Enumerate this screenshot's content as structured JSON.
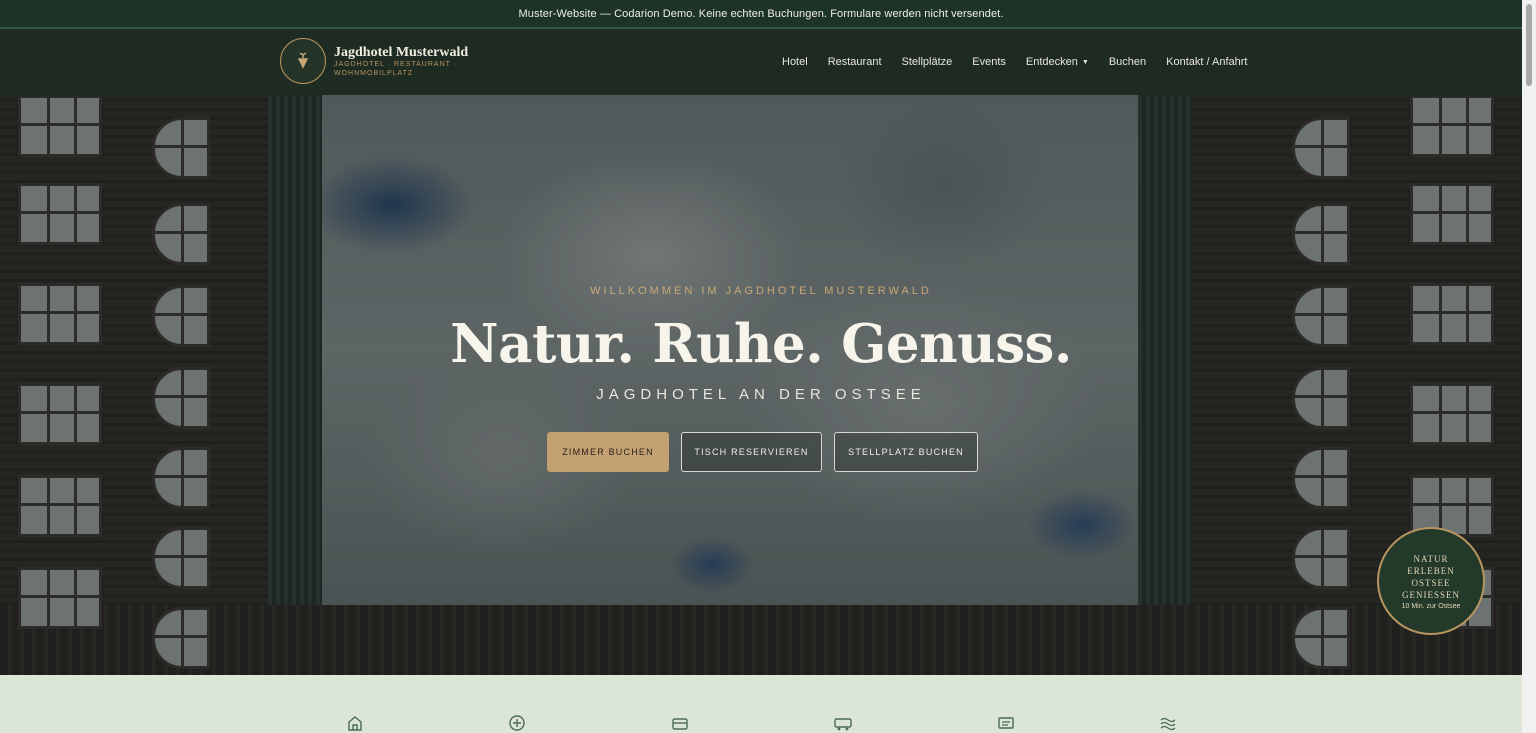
{
  "notice": {
    "text": "Muster-Website — Codarion Demo. Keine echten Buchungen. Formulare werden nicht versendet."
  },
  "brand": {
    "name": "Jagdhotel Musterwald",
    "tagline": "JAGDHOTEL · RESTAURANT · WOHNMOBILPLATZ"
  },
  "nav": {
    "items": [
      {
        "label": "Hotel"
      },
      {
        "label": "Restaurant"
      },
      {
        "label": "Stellplätze"
      },
      {
        "label": "Events"
      },
      {
        "label": "Entdecken"
      },
      {
        "label": "Buchen"
      },
      {
        "label": "Kontakt / Anfahrt"
      }
    ]
  },
  "hero": {
    "eyebrow": "Willkommen im Jagdhotel Musterwald",
    "headline": "Natur. Ruhe. Genuss.",
    "subline": "Jagdhotel an der Ostsee",
    "buttons": {
      "primary": "Zimmer buchen",
      "secondary": "Tisch reservieren",
      "tertiary": "Stellplatz buchen"
    }
  },
  "stamp": {
    "line1": "Natur",
    "line2": "erleben",
    "line3": "Ostsee",
    "line4": "genießen",
    "small": "10 Min. zur Ostsee"
  },
  "feature_icons": [
    "home-icon",
    "plus-circle-icon",
    "card-icon",
    "camper-icon",
    "message-icon",
    "waves-icon"
  ],
  "colors": {
    "header_bg": "#1e2b22",
    "notice_bg": "#1c3326",
    "accent_gold": "#c3a173",
    "strip_bg": "#dbe6d7"
  }
}
